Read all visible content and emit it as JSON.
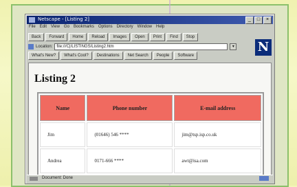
{
  "window": {
    "title": "Netscape - [Listing 2]",
    "controls": [
      "_",
      "□",
      "×"
    ]
  },
  "menu": [
    "File",
    "Edit",
    "View",
    "Go",
    "Bookmarks",
    "Options",
    "Directory",
    "Window",
    "Help"
  ],
  "toolbar": [
    "Back",
    "Forward",
    "Home",
    "Reload",
    "Images",
    "Open",
    "Print",
    "Find",
    "Stop"
  ],
  "location": {
    "label": "Location:",
    "value": "file:///C|/LISTINGS/Listing2.htm"
  },
  "directory_buttons": [
    "What's New?",
    "What's Cool?",
    "Destinations",
    "Net Search",
    "People",
    "Software"
  ],
  "page": {
    "heading": "Listing 2",
    "table": {
      "headers": [
        "Name",
        "Phone number",
        "E-mail address"
      ],
      "rows": [
        [
          "Jim",
          "(01646) 546 ****",
          "jim@tsp.isp.co.uk"
        ],
        [
          "Andrea",
          "0171-666 ****",
          "awt@isa.com"
        ]
      ]
    }
  },
  "status": {
    "text": "Document: Done"
  },
  "colors": {
    "header_fill": "#f06a60",
    "titlebar": "#0b2470",
    "frame_border": "#8bc06a"
  },
  "logo": {
    "letter": "N"
  }
}
